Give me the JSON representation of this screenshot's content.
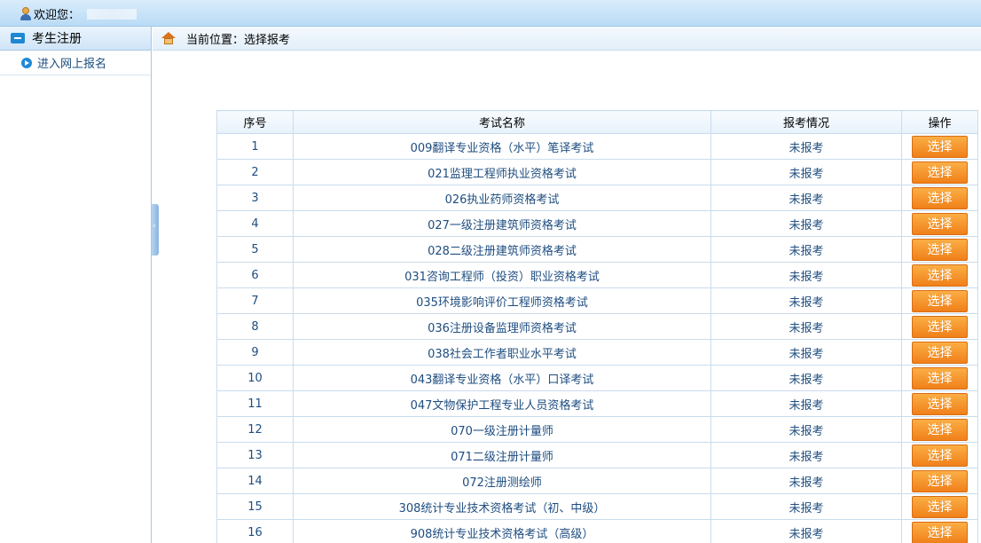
{
  "header": {
    "welcome_label": "欢迎您："
  },
  "sidebar": {
    "section_title": "考生注册",
    "items": [
      {
        "label": "进入网上报名"
      }
    ]
  },
  "breadcrumb": {
    "text": "当前位置：选择报考"
  },
  "table": {
    "headers": [
      "序号",
      "考试名称",
      "报考情况",
      "操作"
    ],
    "button_label": "选择",
    "rows": [
      {
        "index": "1",
        "name": "009翻译专业资格（水平）笔译考试",
        "status": "未报考"
      },
      {
        "index": "2",
        "name": "021监理工程师执业资格考试",
        "status": "未报考"
      },
      {
        "index": "3",
        "name": "026执业药师资格考试",
        "status": "未报考"
      },
      {
        "index": "4",
        "name": "027一级注册建筑师资格考试",
        "status": "未报考"
      },
      {
        "index": "5",
        "name": "028二级注册建筑师资格考试",
        "status": "未报考"
      },
      {
        "index": "6",
        "name": "031咨询工程师（投资）职业资格考试",
        "status": "未报考"
      },
      {
        "index": "7",
        "name": "035环境影响评价工程师资格考试",
        "status": "未报考"
      },
      {
        "index": "8",
        "name": "036注册设备监理师资格考试",
        "status": "未报考"
      },
      {
        "index": "9",
        "name": "038社会工作者职业水平考试",
        "status": "未报考"
      },
      {
        "index": "10",
        "name": "043翻译专业资格（水平）口译考试",
        "status": "未报考"
      },
      {
        "index": "11",
        "name": "047文物保护工程专业人员资格考试",
        "status": "未报考"
      },
      {
        "index": "12",
        "name": "070一级注册计量师",
        "status": "未报考"
      },
      {
        "index": "13",
        "name": "071二级注册计量师",
        "status": "未报考"
      },
      {
        "index": "14",
        "name": "072注册测绘师",
        "status": "未报考"
      },
      {
        "index": "15",
        "name": "308统计专业技术资格考试（初、中级）",
        "status": "未报考"
      },
      {
        "index": "16",
        "name": "908统计专业技术资格考试（高级）",
        "status": "未报考"
      }
    ]
  },
  "colors": {
    "accent_button": "#f0801a",
    "header_blue": "#b9dbf6",
    "link_blue": "#1e4d80"
  }
}
